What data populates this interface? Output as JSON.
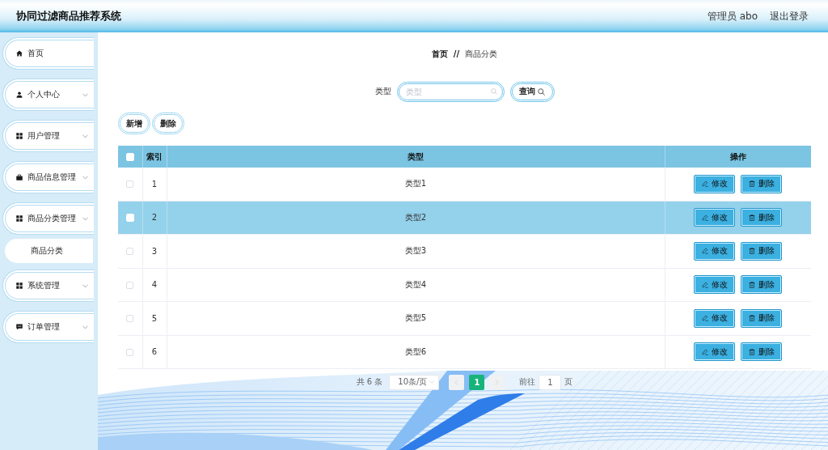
{
  "header": {
    "title": "协同过滤商品推荐系统",
    "user": "管理员 abo",
    "logout": "退出登录"
  },
  "sidebar": {
    "items": [
      {
        "label": "首页",
        "kind": "link"
      },
      {
        "label": "个人中心",
        "kind": "submenu"
      },
      {
        "label": "用户管理",
        "kind": "submenu"
      },
      {
        "label": "商品信息管理",
        "kind": "submenu"
      },
      {
        "label": "商品分类管理",
        "kind": "submenu",
        "children": [
          {
            "label": "商品分类"
          }
        ]
      },
      {
        "label": "系统管理",
        "kind": "submenu"
      },
      {
        "label": "订单管理",
        "kind": "submenu"
      }
    ]
  },
  "breadcrumb": {
    "items": [
      "首页",
      "商品分类"
    ],
    "separator": "//"
  },
  "search": {
    "label": "类型",
    "placeholder": "类型",
    "button": "查询"
  },
  "toolbar": {
    "buttons": [
      "新增",
      "删除"
    ]
  },
  "table": {
    "select_all": {
      "checked": false
    },
    "columns": [
      "索引",
      "类型",
      "操作"
    ],
    "rows": [
      {
        "checked": false,
        "selected": false,
        "index": "1",
        "type": "类型1",
        "actions": [
          "修改",
          "删除"
        ]
      },
      {
        "checked": false,
        "selected": true,
        "index": "2",
        "type": "类型2",
        "actions": [
          "修改",
          "删除"
        ]
      },
      {
        "checked": false,
        "selected": false,
        "index": "3",
        "type": "类型3",
        "actions": [
          "修改",
          "删除"
        ]
      },
      {
        "checked": false,
        "selected": false,
        "index": "4",
        "type": "类型4",
        "actions": [
          "修改",
          "删除"
        ]
      },
      {
        "checked": false,
        "selected": false,
        "index": "5",
        "type": "类型5",
        "actions": [
          "修改",
          "删除"
        ]
      },
      {
        "checked": false,
        "selected": false,
        "index": "6",
        "type": "类型6",
        "actions": [
          "修改",
          "删除"
        ]
      }
    ]
  },
  "pagination": {
    "total": "共 6 条",
    "page_size": "10条/页",
    "prev": {
      "disabled": true
    },
    "pages": [
      {
        "label": "1",
        "selected": true
      }
    ],
    "next": {
      "disabled": true
    },
    "goto_label": "前往",
    "goto_value": "1",
    "goto_suffix": "页"
  }
}
